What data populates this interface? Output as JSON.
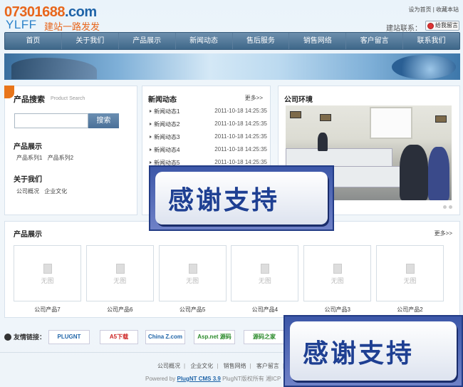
{
  "header": {
    "logo_number": "07301688",
    "logo_domain": ".com",
    "logo_ylff": "YLFF",
    "logo_slogan": "建站一路发发",
    "top_links": [
      "设为首页",
      "收藏本站"
    ],
    "contact_label": "建站联系：",
    "message_button": "给我留言"
  },
  "nav": [
    "首页",
    "关于我们",
    "产品展示",
    "新闻动态",
    "售后服务",
    "销售网络",
    "客户留言",
    "联系我们"
  ],
  "left_panel": {
    "search_title": "产品搜索",
    "search_subtitle": "Product Search",
    "search_placeholder": "",
    "search_button": "搜索",
    "products_title": "产品展示",
    "product_links": [
      "产品系列1",
      "产品系列2"
    ],
    "about_title": "关于我们",
    "about_links": [
      "公司概况",
      "企业文化"
    ]
  },
  "news": {
    "title": "新闻动态",
    "more": "更多>>",
    "items": [
      {
        "title": "新闻动态1",
        "date": "2011-10-18 14:25:35"
      },
      {
        "title": "新闻动态2",
        "date": "2011-10-18 14:25:35"
      },
      {
        "title": "新闻动态3",
        "date": "2011-10-18 14:25:35"
      },
      {
        "title": "新闻动态4",
        "date": "2011-10-18 14:25:35"
      },
      {
        "title": "新闻动态5",
        "date": "2011-10-18 14:25:35"
      }
    ]
  },
  "environment": {
    "title": "公司环境"
  },
  "products": {
    "title": "产品展示",
    "more": "更多>>",
    "no_image": "无图",
    "items": [
      "公司产品7",
      "公司产品6",
      "公司产品5",
      "公司产品4",
      "公司产品3",
      "公司产品2"
    ]
  },
  "friend_links": {
    "label": "友情链接：",
    "items": [
      "PLUGNT",
      "A5下载",
      "China Z.com",
      "Asp.net 源码",
      "源码之家"
    ]
  },
  "footer": {
    "links": [
      "公司概况",
      "企业文化",
      "销售网络",
      "客户留言"
    ],
    "powered_prefix": "Powered by",
    "powered_brand": "PlugNT CMS 3.9",
    "powered_suffix": "PlugNT版权所有 湘ICP"
  },
  "overlay": {
    "thanks_text": "感谢支持"
  },
  "colors": {
    "accent_orange": "#e8661b",
    "brand_blue": "#1f64a8",
    "nav_blue": "#4a7098"
  }
}
